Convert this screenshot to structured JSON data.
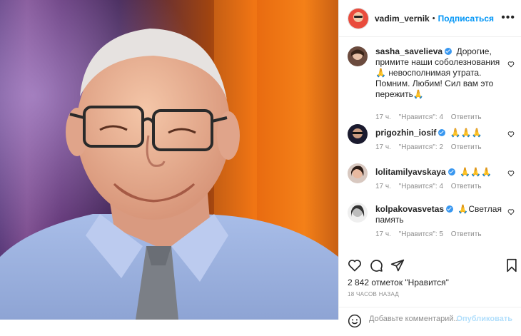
{
  "post": {
    "author": "vadim_vernik",
    "separator": "•",
    "follow_label": "Подписаться",
    "more_icon": "•••",
    "image_alt_icon": "portrait-photo"
  },
  "comments": [
    {
      "user": "sasha_savelieva",
      "verified": true,
      "text": "Дорогие, примите наши соболезнования 🙏 невосполнимая утрата. Помним. Любим! Сил вам это пережить🙏",
      "age": "17 ч.",
      "likes": "\"Нравится\": 4",
      "reply": "Ответить"
    },
    {
      "user": "prigozhin_iosif",
      "verified": true,
      "text": "🙏🙏🙏",
      "age": "17 ч.",
      "likes": "\"Нравится\": 2",
      "reply": "Ответить"
    },
    {
      "user": "lolitamilyavskaya",
      "verified": true,
      "text": "🙏🙏🙏",
      "age": "17 ч.",
      "likes": "\"Нравится\": 4",
      "reply": "Ответить"
    },
    {
      "user": "kolpakovasvetas",
      "verified": true,
      "text": "🙏Светлая память",
      "age": "17 ч.",
      "likes": "\"Нравится\": 5",
      "reply": "Ответить"
    }
  ],
  "stats": {
    "likes_text": "2 842 отметок \"Нравится\"",
    "posted": "18 ЧАСОВ НАЗАД"
  },
  "add_comment": {
    "placeholder": "Добавьте комментарий...",
    "publish": "Опубликовать"
  },
  "colors": {
    "accent": "#0095f6",
    "verified": "#3897f0",
    "muted": "#8e8e8e"
  }
}
